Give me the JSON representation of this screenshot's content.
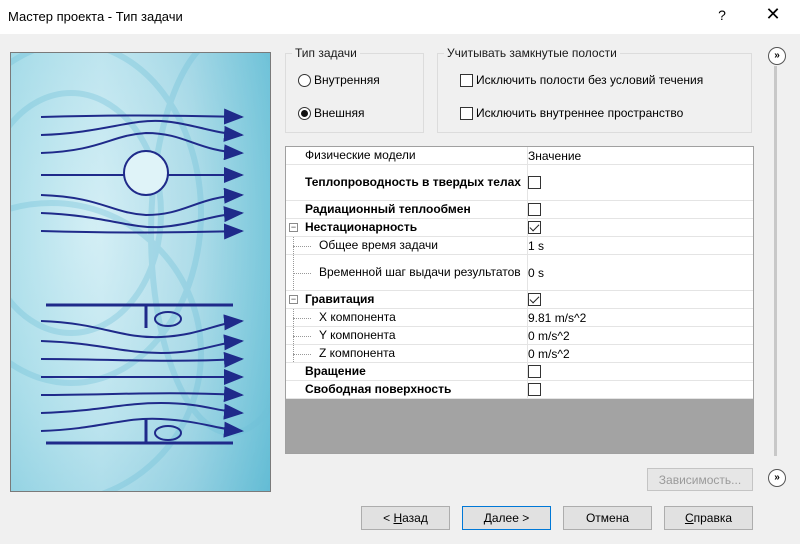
{
  "window": {
    "title": "Мастер проекта - Тип задачи",
    "help": "?",
    "close": "✕"
  },
  "task_type": {
    "legend": "Тип задачи",
    "options": [
      {
        "label": "Внутренняя",
        "selected": false
      },
      {
        "label": "Внешняя",
        "selected": true
      }
    ]
  },
  "closed_cavities": {
    "legend": "Учитывать замкнутые полости",
    "options": [
      {
        "label": "Исключить полости без условий течения",
        "checked": false
      },
      {
        "label": "Исключить внутреннее пространство",
        "checked": false
      }
    ]
  },
  "grid": {
    "header": {
      "name": "Физические модели",
      "value": "Значение"
    },
    "rows": [
      {
        "name": "Теплопроводность в твердых телах",
        "type": "check",
        "checked": false
      },
      {
        "name": "Радиационный теплообмен",
        "type": "check",
        "checked": false
      },
      {
        "name": "Нестационарность",
        "type": "check",
        "checked": true,
        "expander": "−"
      },
      {
        "name": "Общее время задачи",
        "value": "1 s"
      },
      {
        "name": "Временной шаг выдачи результатов",
        "value": "0 s"
      },
      {
        "name": "Гравитация",
        "type": "check",
        "checked": true,
        "expander": "−"
      },
      {
        "name": "X компонента",
        "value": "9.81 m/s^2"
      },
      {
        "name": "Y компонента",
        "value": "0 m/s^2"
      },
      {
        "name": "Z компонента",
        "value": "0 m/s^2"
      },
      {
        "name": "Вращение",
        "type": "check",
        "checked": false
      },
      {
        "name": "Свободная поверхность",
        "type": "check",
        "checked": false
      }
    ]
  },
  "buttons": {
    "dependency": "Зависимость...",
    "back_hotkey": "Н",
    "back_rest": "азад",
    "back_prefix": "< ",
    "next": "Далее >",
    "cancel": "Отмена",
    "help_hotkey": "С",
    "help_rest": "правка"
  },
  "icons": {
    "side_expand": "»"
  }
}
